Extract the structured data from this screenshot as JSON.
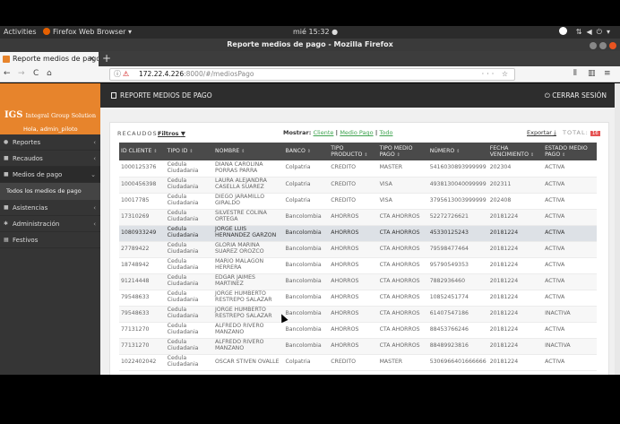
{
  "system": {
    "activities": "Activities",
    "app_menu": "Firefox Web Browser ▾",
    "clock": "mié 15:32 ●"
  },
  "window": {
    "title": "Reporte medios de pago - Mozilla Firefox"
  },
  "tab": {
    "label": "Reporte medios de pago",
    "close": "✕",
    "new": "+"
  },
  "nav": {
    "back": "←",
    "forward": "→",
    "reload": "C",
    "home": "⌂",
    "url_host": "172.22.4.226",
    "url_path": ":8000/#/mediosPago",
    "url_tail": "··· ☆"
  },
  "brand": {
    "logo_main": "IGS",
    "logo_company": "Integral Group Solution",
    "user": "Hola, admin_piloto"
  },
  "sidebar": {
    "items": [
      {
        "label": "Reportes",
        "chevron": "‹"
      },
      {
        "label": "Recaudos",
        "chevron": "‹"
      },
      {
        "label": "Medios de pago",
        "chevron": "⌄"
      }
    ],
    "sub_item": "Todos los medios de pago",
    "items2": [
      {
        "label": "Asistencias",
        "chevron": "‹"
      },
      {
        "label": "Administración",
        "chevron": "‹"
      },
      {
        "label": "Festivos",
        "chevron": ""
      }
    ]
  },
  "header": {
    "title": "REPORTE MEDIOS DE PAGO",
    "logout": "CERRAR SESIÓN"
  },
  "toolbar": {
    "recaudos": "RECAUDOS:",
    "filtros": "Filtros",
    "mostrar": "Mostrar:",
    "cliente": "Cliente",
    "medio_pago": "Medio Pago",
    "todo": "Todo",
    "exportar": "Exportar",
    "total": "TOTAL:",
    "total_count": "16"
  },
  "table": {
    "headers": [
      "ID CLIENTE",
      "TIPO ID",
      "NOMBRE",
      "BANCO",
      "TIPO PRODUCTO",
      "TIPO MEDIO PAGO",
      "NÚMERO",
      "FECHA VENCIMIENTO",
      "ESTADO MEDIO PAGO"
    ],
    "rows": [
      [
        "1000125376",
        "Cedula Ciudadania",
        "DIANA CAROLINA PORRAS PARRA",
        "Colpatria",
        "CREDITO",
        "MASTER",
        "5416030893999999",
        "202304",
        "ACTIVA"
      ],
      [
        "1000456398",
        "Cedula Ciudadania",
        "LAURA ALEJANDRA CASELLA SUAREZ",
        "Colpatria",
        "CREDITO",
        "VISA",
        "4938130040099999",
        "202311",
        "ACTIVA"
      ],
      [
        "10017785",
        "Cedula Ciudadania",
        "DIEGO JARAMILLO GIRALDO",
        "Colpatria",
        "CREDITO",
        "VISA",
        "3795613003999999",
        "202408",
        "ACTIVA"
      ],
      [
        "17310269",
        "Cedula Ciudadania",
        "SILVESTRE COLINA ORTEGA",
        "Bancolombia",
        "AHORROS",
        "CTA AHORROS",
        "52272726621",
        "20181224",
        "ACTIVA"
      ],
      [
        "1080933249",
        "Cedula Ciudadania",
        "JORGE LUIS HERNANDEZ GARZON",
        "Bancolombia",
        "AHORROS",
        "CTA AHORROS",
        "45330125243",
        "20181224",
        "ACTIVA"
      ],
      [
        "27789422",
        "Cedula Ciudadania",
        "GLORIA MARINA SUAREZ OROZCO",
        "Bancolombia",
        "AHORROS",
        "CTA AHORROS",
        "79598477464",
        "20181224",
        "ACTIVA"
      ],
      [
        "18748942",
        "Cedula Ciudadania",
        "MARIO MALAGON HERRERA",
        "Bancolombia",
        "AHORROS",
        "CTA AHORROS",
        "95790549353",
        "20181224",
        "ACTIVA"
      ],
      [
        "91214448",
        "Cedula Ciudadania",
        "EDGAR JAIMES MARTINEZ",
        "Bancolombia",
        "AHORROS",
        "CTA AHORROS",
        "7882936460",
        "20181224",
        "ACTIVA"
      ],
      [
        "79548633",
        "Cedula Ciudadania",
        "JORGE HUMBERTO RESTREPO SALAZAR",
        "Bancolombia",
        "AHORROS",
        "CTA AHORROS",
        "10852451774",
        "20181224",
        "ACTIVA"
      ],
      [
        "79548633",
        "Cedula Ciudadania",
        "JORGE HUMBERTO RESTREPO SALAZAR",
        "Bancolombia",
        "AHORROS",
        "CTA AHORROS",
        "61407547186",
        "20181224",
        "INACTIVA"
      ],
      [
        "77131270",
        "Cedula Ciudadania",
        "ALFREDO RIVERO MANZANO",
        "Bancolombia",
        "AHORROS",
        "CTA AHORROS",
        "88453766246",
        "20181224",
        "ACTIVA"
      ],
      [
        "77131270",
        "Cedula Ciudadania",
        "ALFREDO RIVERO MANZANO",
        "Bancolombia",
        "AHORROS",
        "CTA AHORROS",
        "88489923816",
        "20181224",
        "INACTIVA"
      ],
      [
        "1022402042",
        "Cedula Ciudadania",
        "OSCAR STIVEN OVALLE",
        "Colpatria",
        "CREDITO",
        "MASTER",
        "5306966401666666",
        "20181224",
        "ACTIVA"
      ]
    ]
  }
}
